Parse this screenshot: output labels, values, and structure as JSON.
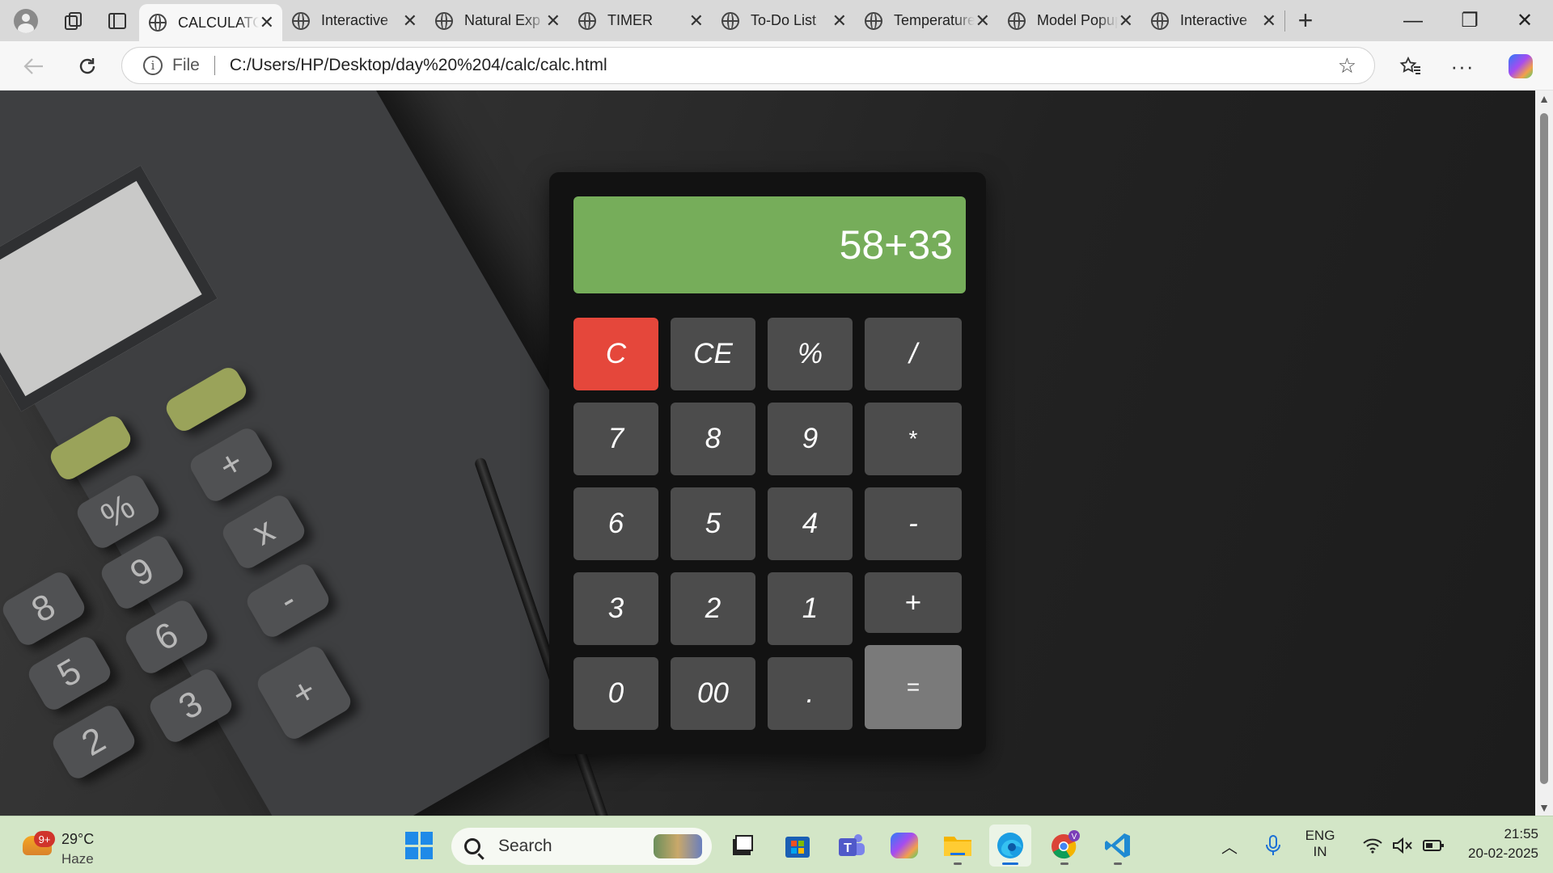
{
  "browser": {
    "tabs": [
      {
        "title": "CALCULATOR",
        "active": true
      },
      {
        "title": "Interactive",
        "active": false
      },
      {
        "title": "Natural Exp",
        "active": false
      },
      {
        "title": "TIMER",
        "active": false
      },
      {
        "title": "To-Do List",
        "active": false
      },
      {
        "title": "Temperature",
        "active": false
      },
      {
        "title": "Model Popup",
        "active": false
      },
      {
        "title": "Interactive",
        "active": false
      }
    ],
    "close_glyph": "✕",
    "new_tab_glyph": "+",
    "address": {
      "scheme_label": "File",
      "url": "C:/Users/HP/Desktop/day%20%204/calc/calc.html"
    },
    "window_controls": {
      "minimize": "—",
      "restore": "❐",
      "close": "✕"
    },
    "icons": [
      "profile-icon",
      "workspaces-icon",
      "tab-actions-icon",
      "globe-icon",
      "back-icon",
      "refresh-icon",
      "info-icon",
      "favorite-star-icon",
      "favorites-icon",
      "more-icon",
      "copilot-icon"
    ]
  },
  "calculator": {
    "display": "58+33",
    "rows": [
      [
        "C",
        "CE",
        "%",
        "/"
      ],
      [
        "7",
        "8",
        "9",
        "*"
      ],
      [
        "6",
        "5",
        "4",
        "-"
      ],
      [
        "3",
        "2",
        "1",
        "+"
      ],
      [
        "0",
        "00",
        ".",
        "="
      ]
    ],
    "colors": {
      "display": "#76ad5a",
      "clear": "#e5473b",
      "key": "#4c4c4c",
      "equals": "#7a7a7a",
      "body": "#121212"
    }
  },
  "background_keys": [
    "+",
    "%",
    "x",
    "9",
    "8",
    "-",
    "6",
    "5",
    "+",
    "3",
    "2"
  ],
  "taskbar": {
    "weather": {
      "badge": "9+",
      "temp": "29°C",
      "condition": "Haze"
    },
    "search_placeholder": "Search",
    "tray": {
      "lang_line1": "ENG",
      "lang_line2": "IN",
      "time": "21:55",
      "date": "20-02-2025"
    },
    "apps": [
      "windows-start-icon",
      "task-view-icon",
      "microsoft-store-icon",
      "teams-icon",
      "copilot-icon",
      "file-explorer-icon",
      "edge-icon",
      "chrome-icon",
      "vscode-icon"
    ]
  }
}
